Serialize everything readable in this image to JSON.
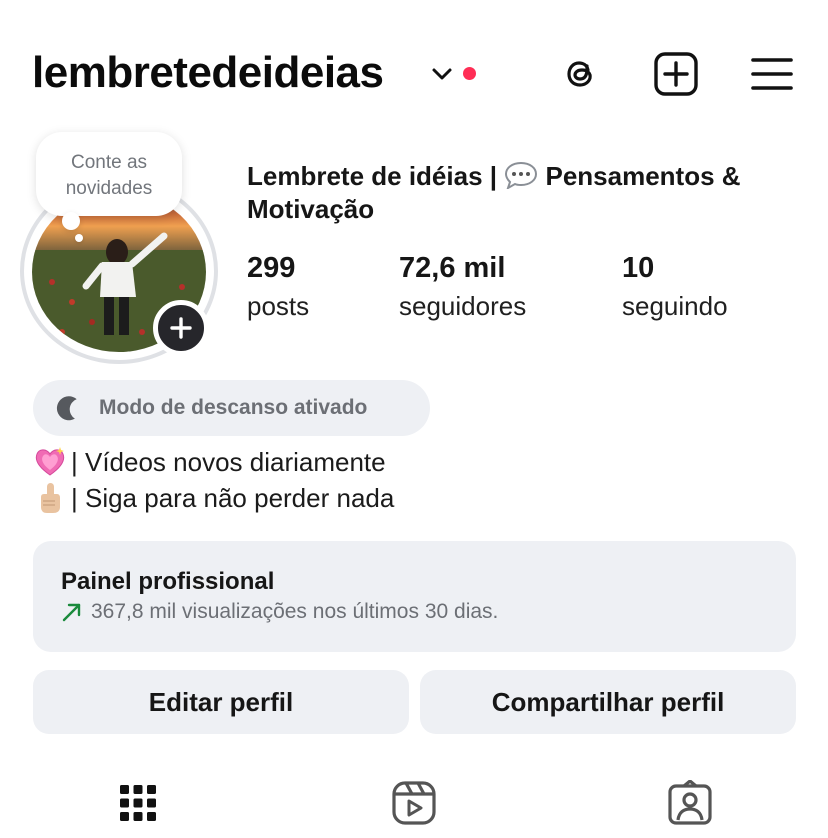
{
  "header": {
    "username": "lembretedeideias",
    "icons": [
      "chevron-down-icon",
      "threads-icon",
      "new-post-icon",
      "menu-icon"
    ],
    "notification_color": "#ff2d55"
  },
  "avatar": {
    "note_text": "Conte as novidades"
  },
  "profile": {
    "name_part1": "Lembrete de idéias | ",
    "name_part2": " Pensamentos & Motivação",
    "stats": [
      {
        "value": "299",
        "label": "posts"
      },
      {
        "value": "72,6 mil",
        "label": "seguidores"
      },
      {
        "value": "10",
        "label": "seguindo"
      }
    ]
  },
  "rest_mode": {
    "label": "Modo de descanso ativado"
  },
  "bio": {
    "line1": "| Vídeos novos diariamente",
    "line2": "| Siga para não perder nada"
  },
  "pro_panel": {
    "title": "Painel profissional",
    "subtitle": "367,8 mil visualizações nos últimos 30 dias.",
    "trend_color": "#1a8a3c"
  },
  "actions": {
    "edit": "Editar perfil",
    "share": "Compartilhar perfil"
  },
  "tabs": [
    "grid-icon",
    "reels-icon",
    "tagged-icon"
  ]
}
